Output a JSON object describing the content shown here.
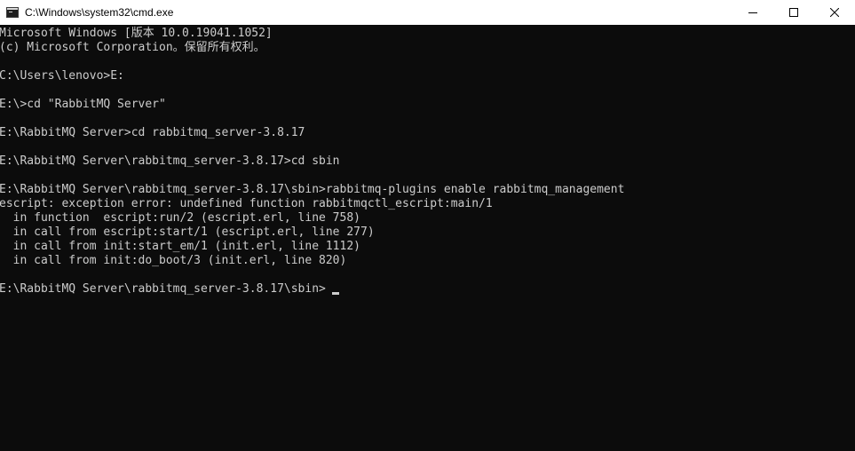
{
  "window": {
    "title": "C:\\Windows\\system32\\cmd.exe",
    "icon": "cmd-icon"
  },
  "controls": {
    "minimize": "minimize-icon",
    "maximize": "maximize-icon",
    "close": "close-icon"
  },
  "console": {
    "lines": [
      "Microsoft Windows [版本 10.0.19041.1052]",
      "(c) Microsoft Corporation。保留所有权利。",
      "",
      "C:\\Users\\lenovo>E:",
      "",
      "E:\\>cd \"RabbitMQ Server\"",
      "",
      "E:\\RabbitMQ Server>cd rabbitmq_server-3.8.17",
      "",
      "E:\\RabbitMQ Server\\rabbitmq_server-3.8.17>cd sbin",
      "",
      "E:\\RabbitMQ Server\\rabbitmq_server-3.8.17\\sbin>rabbitmq-plugins enable rabbitmq_management",
      "escript: exception error: undefined function rabbitmqctl_escript:main/1",
      "  in function  escript:run/2 (escript.erl, line 758)",
      "  in call from escript:start/1 (escript.erl, line 277)",
      "  in call from init:start_em/1 (init.erl, line 1112)",
      "  in call from init:do_boot/3 (init.erl, line 820)",
      "",
      "E:\\RabbitMQ Server\\rabbitmq_server-3.8.17\\sbin>"
    ]
  },
  "colors": {
    "background": "#0c0c0c",
    "text": "#cccccc",
    "titlebar": "#ffffff"
  }
}
